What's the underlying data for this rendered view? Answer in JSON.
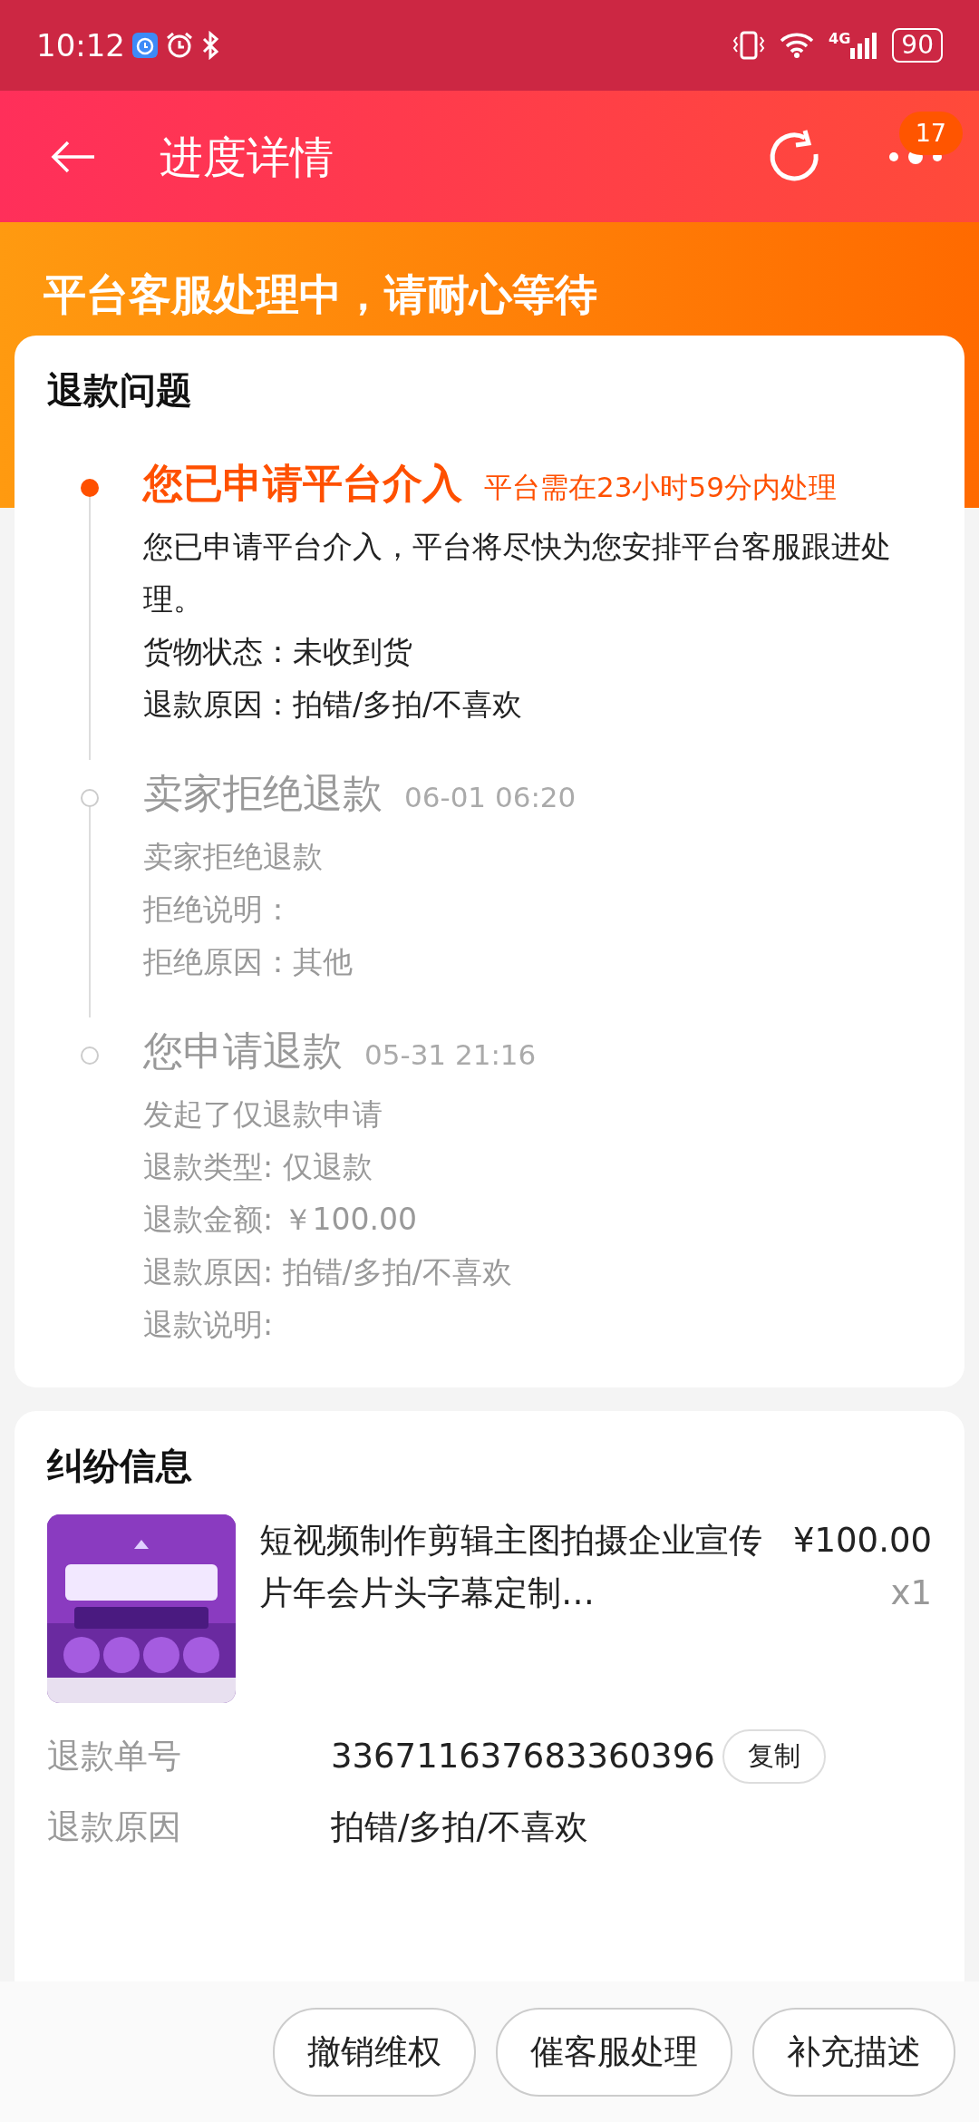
{
  "status_bar": {
    "time": "10:12",
    "network": "4G",
    "battery": "90"
  },
  "header": {
    "title": "进度详情",
    "badge": "17"
  },
  "banner": {
    "text": "平台客服处理中，请耐心等待"
  },
  "progress": {
    "title": "退款问题",
    "steps": [
      {
        "title": "您已申请平台介入",
        "note": "平台需在23小时59分内处理",
        "active": true,
        "lines": [
          "您已申请平台介入，平台将尽快为您安排平台客服跟进处理。",
          "货物状态：未收到货",
          "退款原因：拍错/多拍/不喜欢"
        ]
      },
      {
        "title": "卖家拒绝退款",
        "note": "06-01 06:20",
        "active": false,
        "lines": [
          "卖家拒绝退款",
          "拒绝说明：",
          "拒绝原因：其他"
        ]
      },
      {
        "title": "您申请退款",
        "note": "05-31 21:16",
        "active": false,
        "lines": [
          "发起了仅退款申请",
          "退款类型: 仅退款",
          "退款金额: ￥100.00",
          "退款原因: 拍错/多拍/不喜欢",
          "退款说明:"
        ]
      }
    ]
  },
  "dispute": {
    "title": "纠纷信息",
    "product": {
      "kind": "picture",
      "name": "短视频制作剪辑主图拍摄企业宣传片年会片头字幕定制…",
      "price": "¥100.00",
      "quantity": "x1"
    },
    "fields": [
      {
        "label": "退款单号",
        "value": "336711637683360396",
        "action": "复制"
      },
      {
        "label": "退款原因",
        "value": "拍错/多拍/不喜欢"
      }
    ]
  },
  "actions": [
    "撤销维权",
    "催客服处理",
    "补充描述"
  ]
}
